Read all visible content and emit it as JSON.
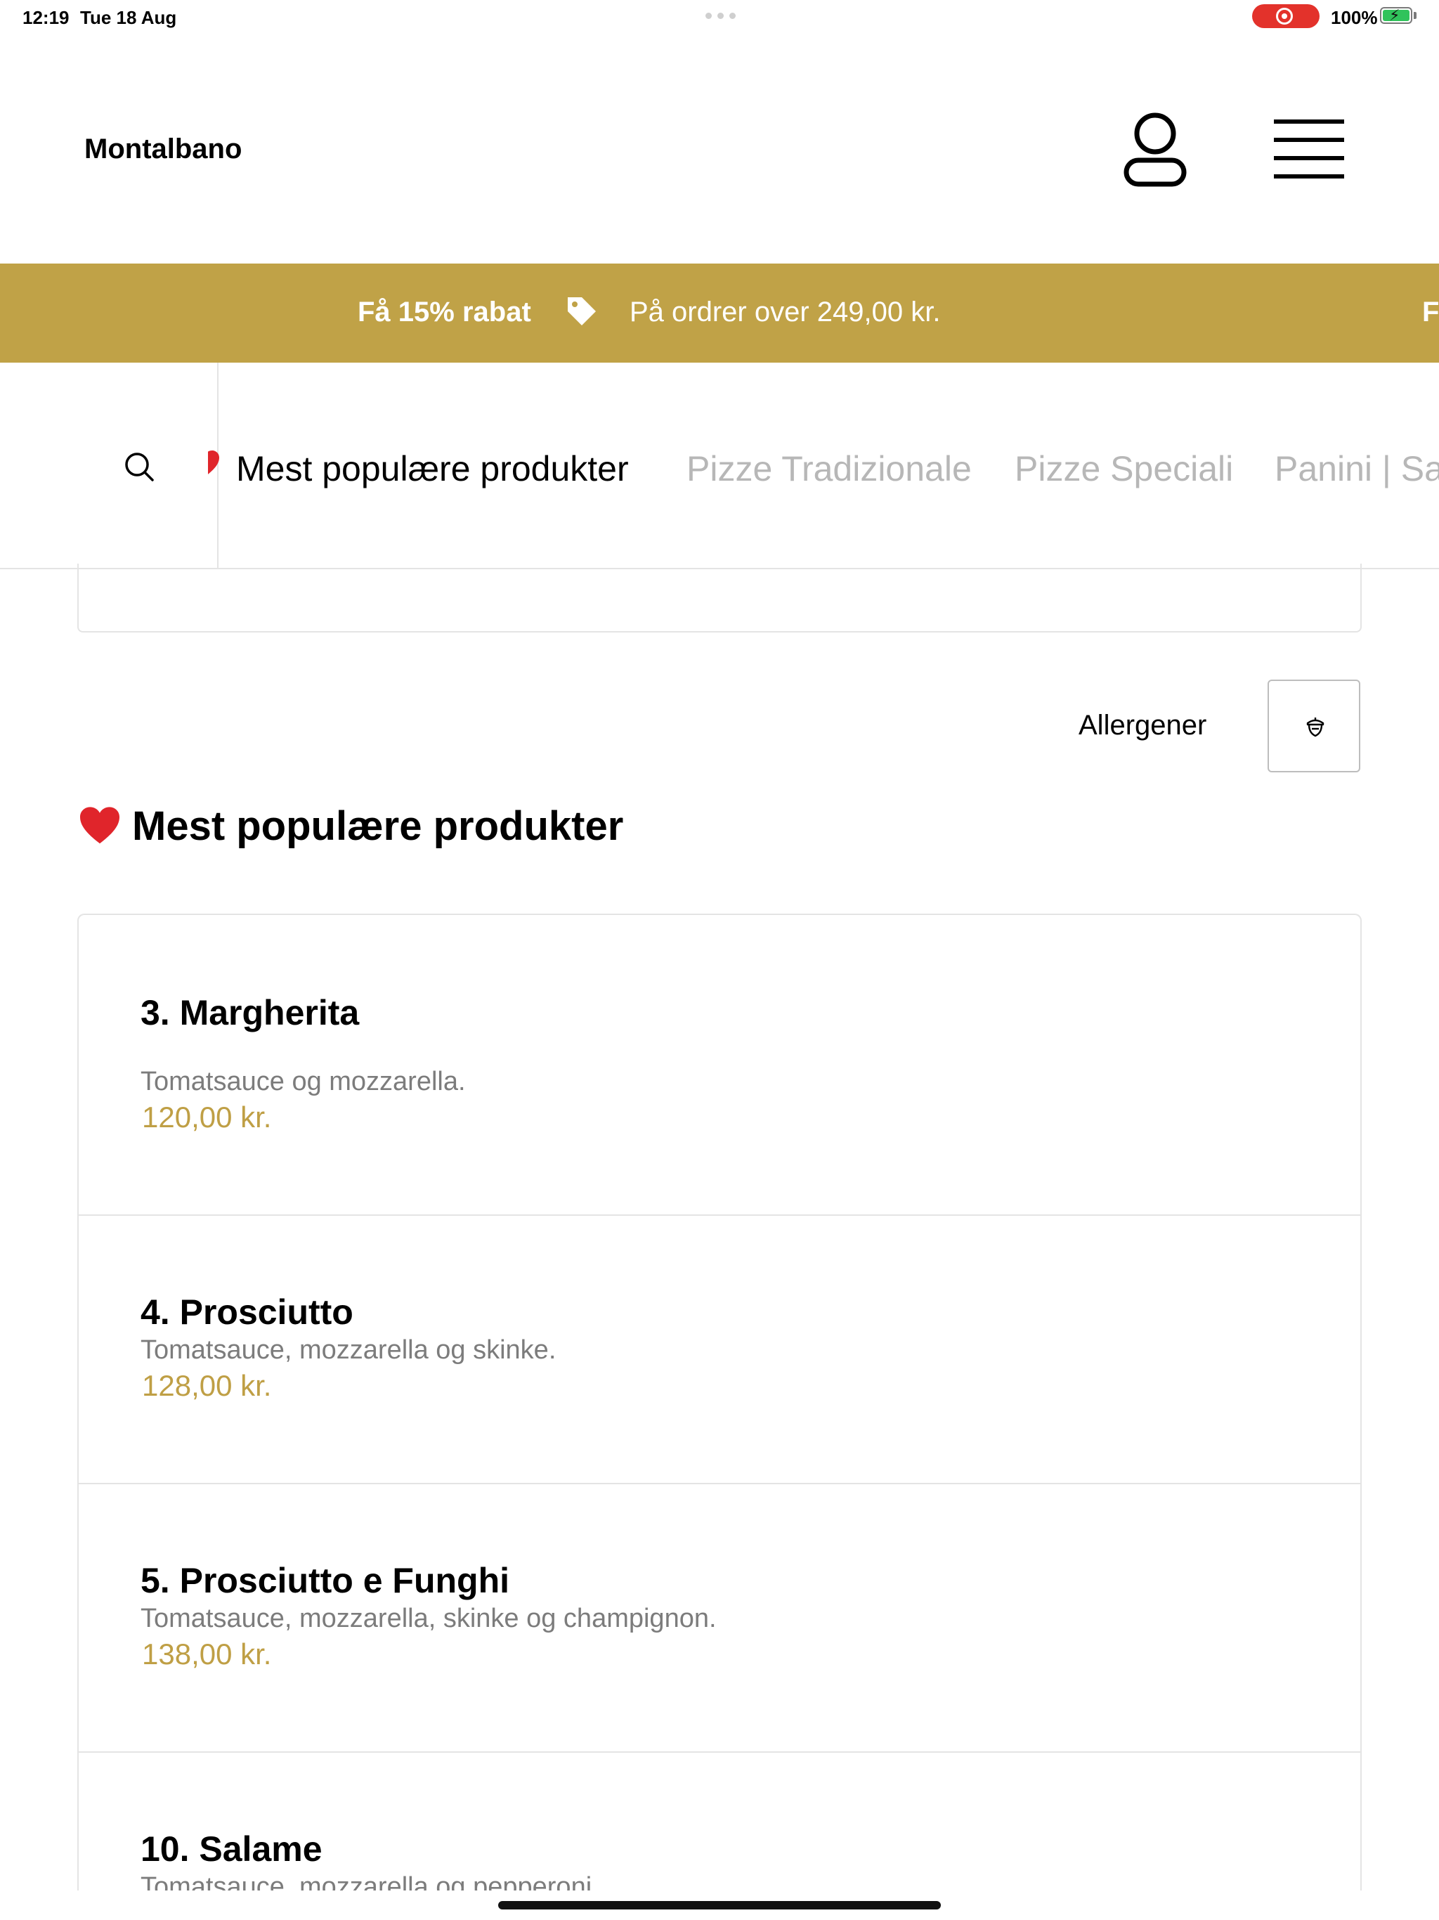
{
  "status_bar": {
    "time": "12:19",
    "date": "Tue 18 Aug",
    "battery": "100%"
  },
  "header": {
    "brand": "Montalbano"
  },
  "promo": {
    "bold": "Få 15% rabat",
    "text": "På ordrer over 249,00 kr.",
    "next_clip": "F"
  },
  "nav": {
    "tabs": [
      {
        "label": "Mest populære produkter",
        "active": true
      },
      {
        "label": "Pizze Tradizionale",
        "active": false
      },
      {
        "label": "Pizze Speciali",
        "active": false
      },
      {
        "label": "Panini | Sa",
        "active": false
      }
    ]
  },
  "allergen": {
    "label": "Allergener"
  },
  "section": {
    "title": "Mest populære produkter"
  },
  "products": [
    {
      "name": "3. Margherita",
      "desc": "Tomatsauce og mozzarella.",
      "price": "120,00 kr."
    },
    {
      "name": "4. Prosciutto",
      "desc": "Tomatsauce, mozzarella og skinke.",
      "price": "128,00 kr."
    },
    {
      "name": "5. Prosciutto e Funghi",
      "desc": "Tomatsauce, mozzarella, skinke og champignon.",
      "price": "138,00 kr."
    },
    {
      "name": "10. Salame",
      "desc": "Tomatsauce, mozzarella og pepperoni."
    }
  ],
  "colors": {
    "accent": "#c0a247",
    "price": "#bf9f45",
    "muted": "#7c7c7c",
    "record": "#e3322b",
    "battery": "#30c35b"
  }
}
